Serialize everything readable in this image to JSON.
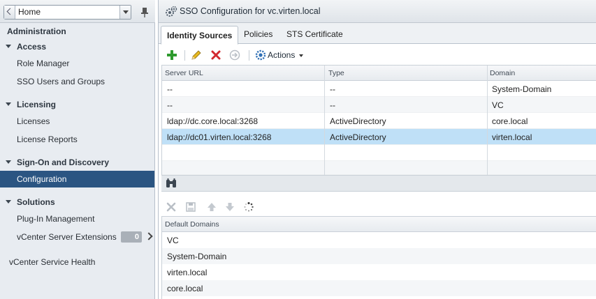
{
  "nav": {
    "home_label": "Home",
    "section_title": "Administration",
    "categories": [
      {
        "label": "Access",
        "items": [
          "Role Manager",
          "SSO Users and Groups"
        ]
      },
      {
        "label": "Licensing",
        "items": [
          "Licenses",
          "License Reports"
        ]
      },
      {
        "label": "Sign-On and Discovery",
        "items": [
          "Configuration"
        ]
      },
      {
        "label": "Solutions",
        "items": [
          "Plug-In Management",
          "vCenter Server Extensions"
        ]
      }
    ],
    "extensions_badge": "0",
    "service_health": "vCenter Service Health"
  },
  "main": {
    "title": "SSO Configuration for vc.virten.local",
    "tabs": [
      {
        "label": "Identity Sources",
        "active": true
      },
      {
        "label": "Policies",
        "active": false
      },
      {
        "label": "STS Certificate",
        "active": false
      }
    ],
    "actions_label": "Actions",
    "identity_sources": {
      "columns": [
        "Server URL",
        "Type",
        "Domain"
      ],
      "rows": [
        [
          "--",
          "--",
          "System-Domain"
        ],
        [
          "--",
          "--",
          "VC"
        ],
        [
          "ldap://dc.core.local:3268",
          "ActiveDirectory",
          "core.local"
        ],
        [
          "ldap://dc01.virten.local:3268",
          "ActiveDirectory",
          "virten.local"
        ]
      ],
      "selected_row": 3
    },
    "default_domains": {
      "column": "Default Domains",
      "rows": [
        "VC",
        "System-Domain",
        "virten.local",
        "core.local"
      ]
    }
  },
  "colors": {
    "selection_nav": "#2b5582",
    "selection_row": "#bfe0f7",
    "add_green": "#2e9a2e",
    "delete_red": "#d2282e"
  }
}
